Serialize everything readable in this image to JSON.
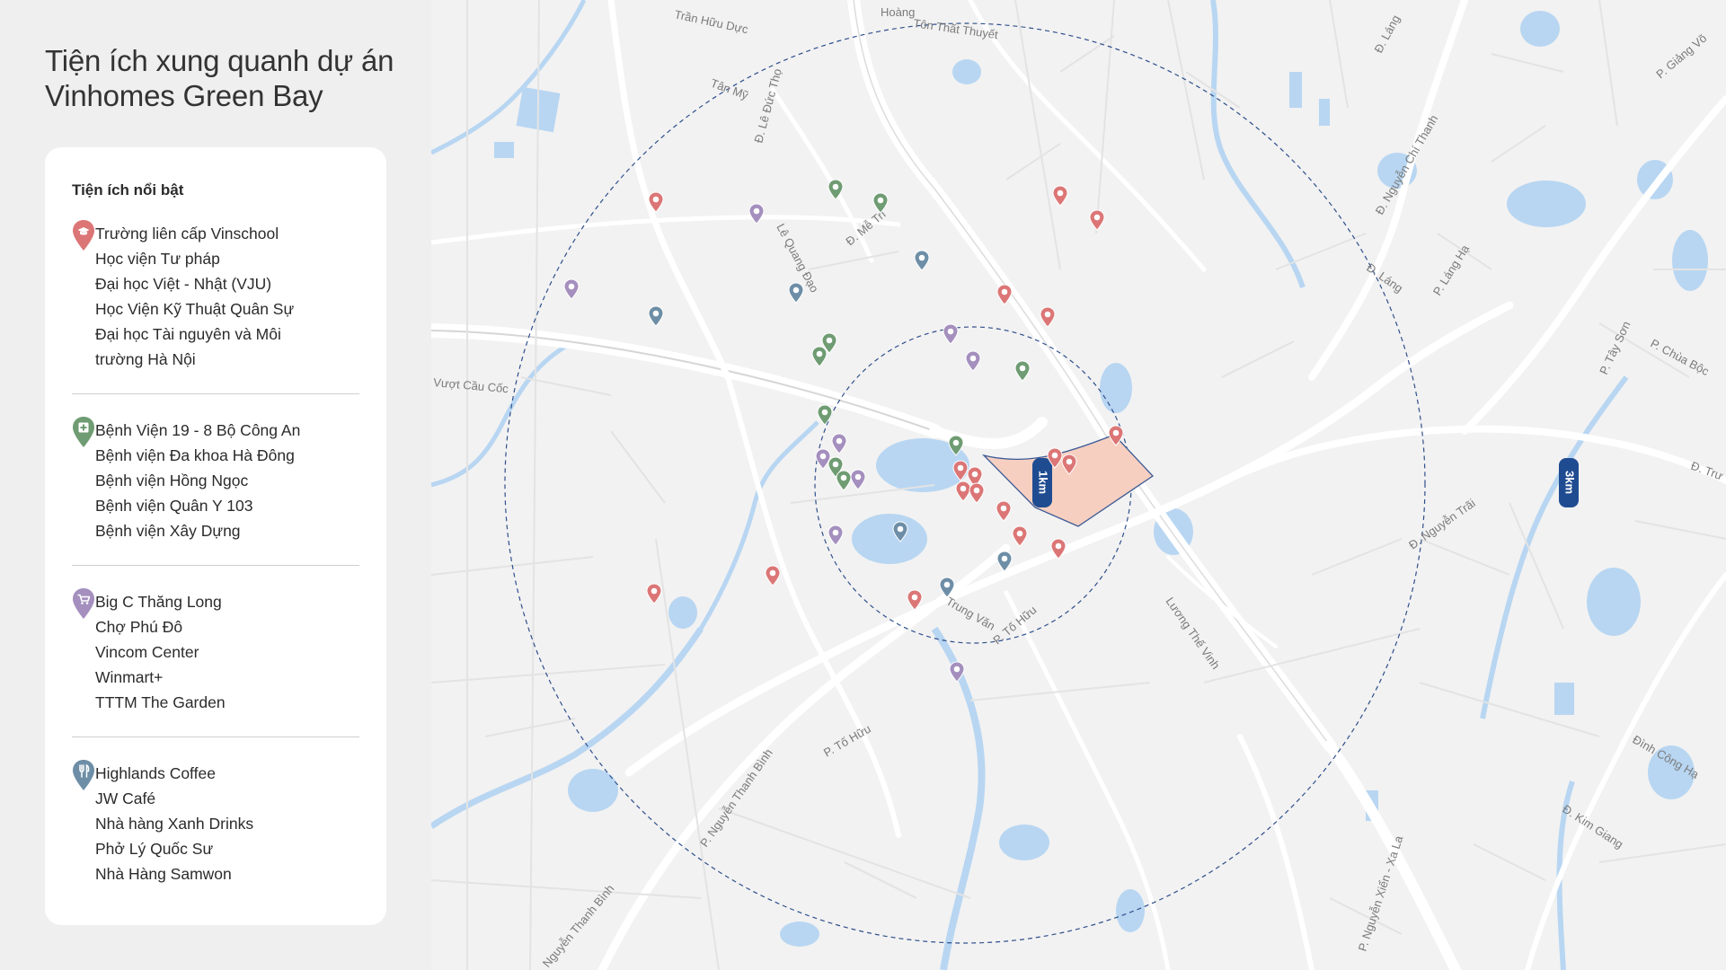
{
  "page": {
    "title_line1": "Tiện ích xung quanh dự án",
    "title_line2": "Vinhomes Green Bay"
  },
  "card": {
    "heading": "Tiện ích nổi bật",
    "groups": [
      {
        "icon": "school-pin-icon",
        "color": "#dc7676",
        "items": [
          "Trường liên cấp Vinschool",
          "Học viện Tư pháp",
          "Đại học Việt - Nhật (VJU)",
          "Học Viện Kỹ Thuật Quân Sự",
          "Đại học Tài nguyên và Môi",
          "trường Hà Nội"
        ]
      },
      {
        "icon": "hospital-pin-icon",
        "color": "#6f9c72",
        "items": [
          "Bệnh Viện 19 - 8 Bộ Công An",
          "Bệnh viện Đa khoa Hà Đông",
          "Bệnh viện Hồng Ngọc",
          "Bệnh viện Quân Y 103",
          "Bệnh viện Xây Dựng"
        ]
      },
      {
        "icon": "shopping-cart-pin-icon",
        "color": "#a48fbe",
        "items": [
          "Big C Thăng Long",
          "Chợ Phú Đô",
          "Vincom Center",
          "Winmart+",
          "TTTM The Garden"
        ]
      },
      {
        "icon": "restaurant-pin-icon",
        "color": "#6d8ea6",
        "items": [
          "Highlands Coffee",
          "JW Café",
          "Nhà hàng Xanh Drinks",
          "Phở Lý Quốc Sư",
          "Nhà Hàng Samwon"
        ]
      }
    ]
  },
  "map": {
    "radius_labels": {
      "inner": "1km",
      "outer": "3km"
    },
    "street_labels": [
      "Tôn Thất Thuyết",
      "Hoàng",
      "Trần Hữu Dực",
      "Tân Mỹ",
      "Đ. Lê Đức Thọ",
      "Đ. Láng",
      "P. Giảng Võ",
      "Đ. Nguyễn Chí Thanh",
      "Đ. Láng",
      "P. Láng Hạ",
      "Lê Quang Đạo",
      "Đ. Mễ Trì",
      "Vượt Cầu Cốc",
      "P. Tây Sơn",
      "P. Chùa Bộc",
      "Đ. Nguyễn Trãi",
      "Đ. Trư",
      "Trung Văn",
      "P. Tố Hữu",
      "Lương Thế Vinh",
      "P. Tố Hữu",
      "P. Nguyễn Thanh Bình",
      "Đình Công Hạ",
      "Đ. Kim Giang",
      "P. Nguyễn Xiển - Xa La",
      "Nguyễn Thanh Bình"
    ],
    "colors": {
      "background": "#f2f2f2",
      "road": "#ffffff",
      "water": "#b8d6f2",
      "circle": "#2e4f8c",
      "project_fill": "#f6cfc0",
      "badge": "#1f4c91"
    }
  }
}
